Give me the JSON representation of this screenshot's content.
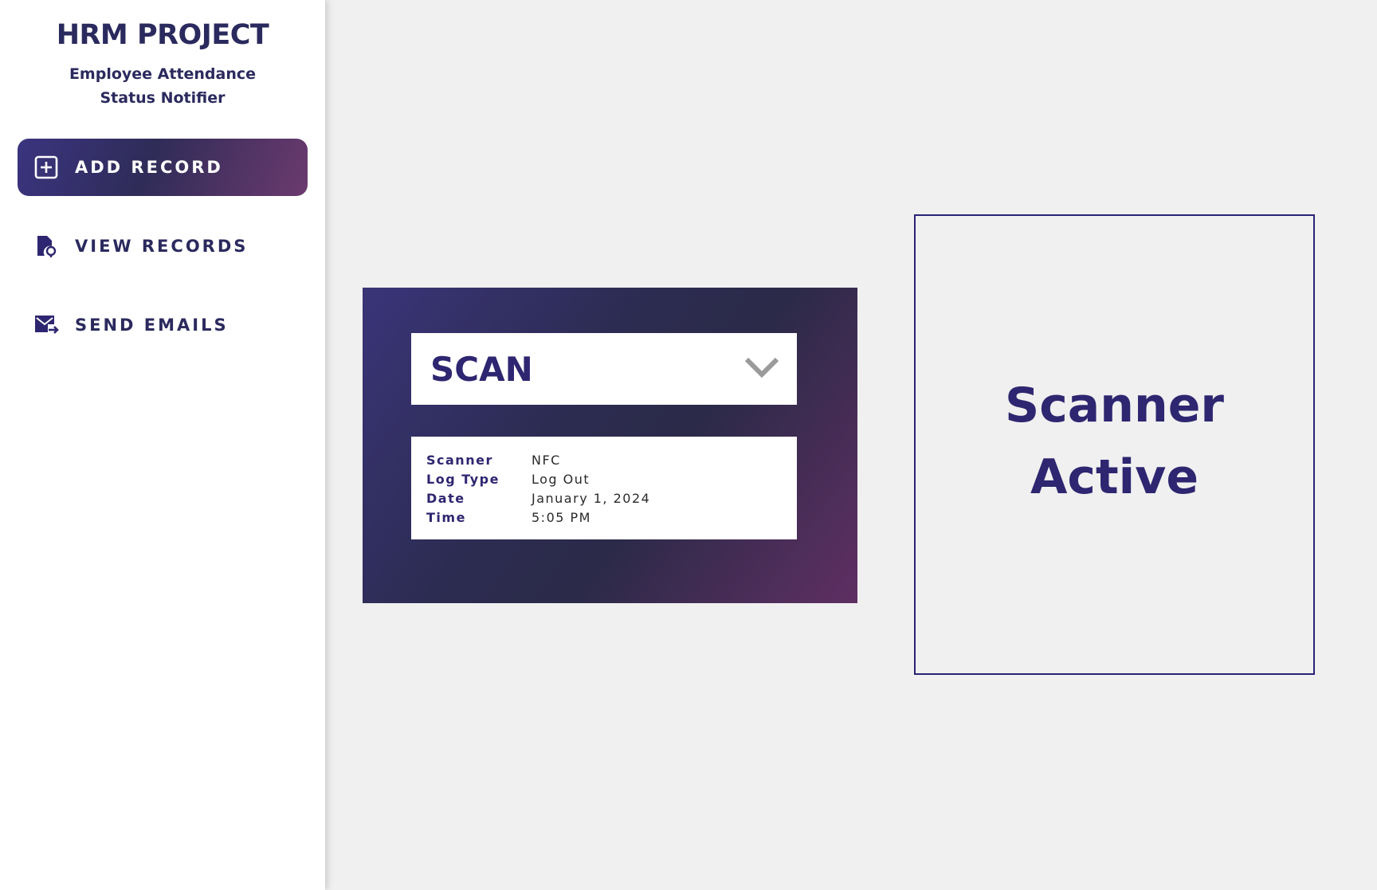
{
  "brand": {
    "title": "HRM PROJECT",
    "subtitle": "Employee Attendance Status Notifier"
  },
  "nav": {
    "items": [
      {
        "label": "ADD RECORD",
        "icon": "plus-square-icon",
        "active": true
      },
      {
        "label": "VIEW RECORDS",
        "icon": "file-search-icon",
        "active": false
      },
      {
        "label": "SEND EMAILS",
        "icon": "mail-send-icon",
        "active": false
      }
    ]
  },
  "scan": {
    "selected": "SCAN",
    "info": [
      {
        "key": "Scanner",
        "value": "NFC"
      },
      {
        "key": "Log Type",
        "value": "Log Out"
      },
      {
        "key": "Date",
        "value": "January 1, 2024"
      },
      {
        "key": "Time",
        "value": "5:05 PM"
      }
    ]
  },
  "status": {
    "line1": "Scanner",
    "line2": "Active"
  },
  "colors": {
    "accent": "#2e2670",
    "brand": "#2b2a5e",
    "gradient_start": "#3b3480",
    "gradient_end": "#6b3a6e",
    "background": "#f0f0f0"
  }
}
